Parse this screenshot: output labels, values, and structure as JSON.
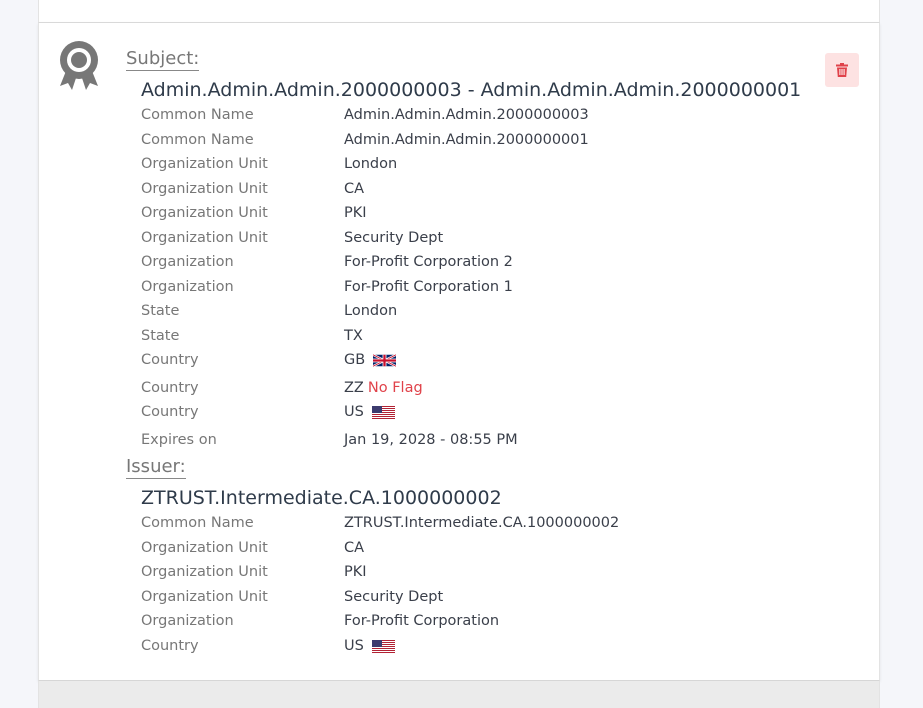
{
  "subject": {
    "heading": "Subject:",
    "name": "Admin.Admin.Admin.2000000003 - Admin.Admin.Admin.2000000001",
    "fields": [
      {
        "label": "Common Name",
        "value": "Admin.Admin.Admin.2000000003"
      },
      {
        "label": "Common Name",
        "value": "Admin.Admin.Admin.2000000001"
      },
      {
        "label": "Organization Unit",
        "value": "London"
      },
      {
        "label": "Organization Unit",
        "value": "CA"
      },
      {
        "label": "Organization Unit",
        "value": "PKI"
      },
      {
        "label": "Organization Unit",
        "value": "Security Dept"
      },
      {
        "label": "Organization",
        "value": "For-Profit Corporation 2"
      },
      {
        "label": "Organization",
        "value": "For-Profit Corporation 1"
      },
      {
        "label": "State",
        "value": "London"
      },
      {
        "label": "State",
        "value": "TX"
      },
      {
        "label": "Country",
        "value": "GB",
        "flag": "uk-flag-icon"
      },
      {
        "label": "Country",
        "value": "ZZ",
        "no_flag_text": "No Flag"
      },
      {
        "label": "Country",
        "value": "US",
        "flag": "us-flag-icon"
      },
      {
        "label": "Expires on",
        "value": "Jan 19, 2028 - 08:55 PM"
      }
    ]
  },
  "issuer": {
    "heading": "Issuer:",
    "name": "ZTRUST.Intermediate.CA.1000000002",
    "fields": [
      {
        "label": "Common Name",
        "value": "ZTRUST.Intermediate.CA.1000000002"
      },
      {
        "label": "Organization Unit",
        "value": "CA"
      },
      {
        "label": "Organization Unit",
        "value": "PKI"
      },
      {
        "label": "Organization Unit",
        "value": "Security Dept"
      },
      {
        "label": "Organization",
        "value": "For-Profit Corporation"
      },
      {
        "label": "Country",
        "value": "US",
        "flag": "us-flag-icon"
      }
    ]
  },
  "icons": {
    "certificate": "certificate-ribbon-icon",
    "delete": "trash-icon"
  },
  "colors": {
    "delete_bg": "#fde2e2",
    "delete_icon": "#e0424a",
    "no_flag": "#e0424a",
    "label": "#777777",
    "value": "#3a3f4a"
  }
}
